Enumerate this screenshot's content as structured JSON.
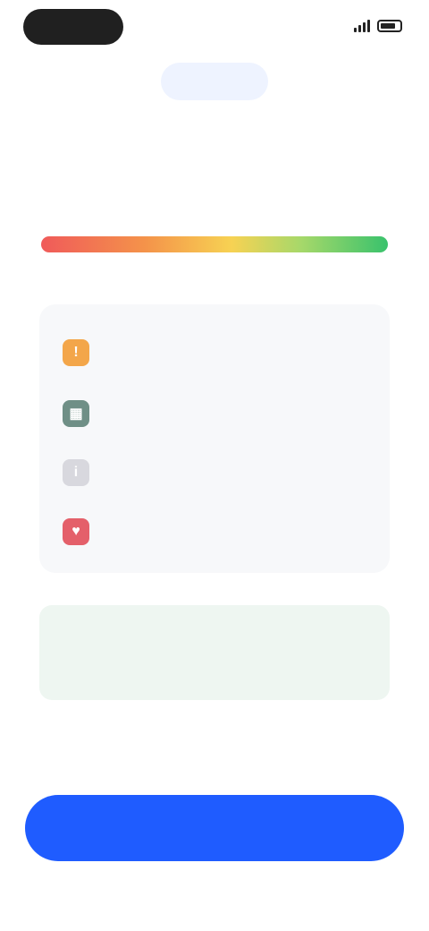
{
  "status_bar": {
    "time": ""
  },
  "header": {
    "chip_label": ""
  },
  "score": {
    "caption": "",
    "value": ""
  },
  "meter": {
    "colors": [
      "#f05a5a",
      "#f4934a",
      "#f7d253",
      "#a6d86a",
      "#39c26c"
    ],
    "left_label": "",
    "middle_label": "",
    "right_label": ""
  },
  "metrics": [
    {
      "icon": "warning-icon",
      "icon_color": "#f3a64a",
      "label": "",
      "value": ""
    },
    {
      "icon": "chart-icon",
      "icon_color": "#6f8f86",
      "label": "",
      "value": ""
    },
    {
      "icon": "info-icon",
      "icon_color": "#d8d8de",
      "label": "",
      "value": ""
    },
    {
      "icon": "heart-icon",
      "icon_color": "#e4606a",
      "label": "",
      "value": ""
    }
  ],
  "tip": {
    "title": "",
    "body": ""
  },
  "primary_button": {
    "label": ""
  },
  "colors": {
    "accent": "#1f5cff",
    "chip_background": "#eef3ff",
    "tip_background": "#eef6f1"
  }
}
